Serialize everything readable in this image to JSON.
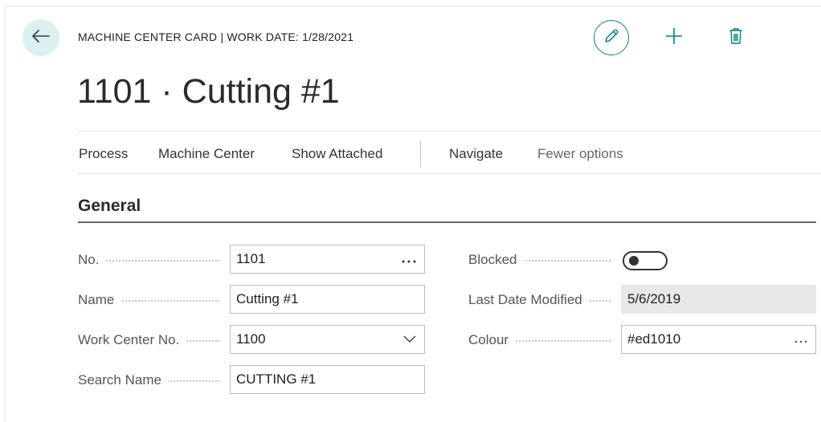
{
  "header": {
    "caption": "MACHINE CENTER CARD | WORK DATE: 1/28/2021",
    "title": "1101 · Cutting #1"
  },
  "actions": {
    "back_icon": "arrow-left-icon",
    "edit_icon": "pencil-icon",
    "new_icon": "plus-icon",
    "delete_icon": "trash-icon"
  },
  "menu": {
    "process": "Process",
    "machine_center": "Machine Center",
    "show_attached": "Show Attached",
    "navigate": "Navigate",
    "fewer_options": "Fewer options"
  },
  "section": {
    "title": "General"
  },
  "fields": {
    "no": {
      "label": "No.",
      "value": "1101"
    },
    "name": {
      "label": "Name",
      "value": "Cutting #1"
    },
    "work_center_no": {
      "label": "Work Center No.",
      "value": "1100"
    },
    "search_name": {
      "label": "Search Name",
      "value": "CUTTING #1"
    },
    "blocked": {
      "label": "Blocked",
      "value": false
    },
    "last_date_modified": {
      "label": "Last Date Modified",
      "value": "5/6/2019"
    },
    "colour": {
      "label": "Colour",
      "value": "#ed1010"
    }
  },
  "colors": {
    "accent": "#008489",
    "back_button_bg": "#dcf0f0",
    "section_rule": "#5c6a78"
  }
}
